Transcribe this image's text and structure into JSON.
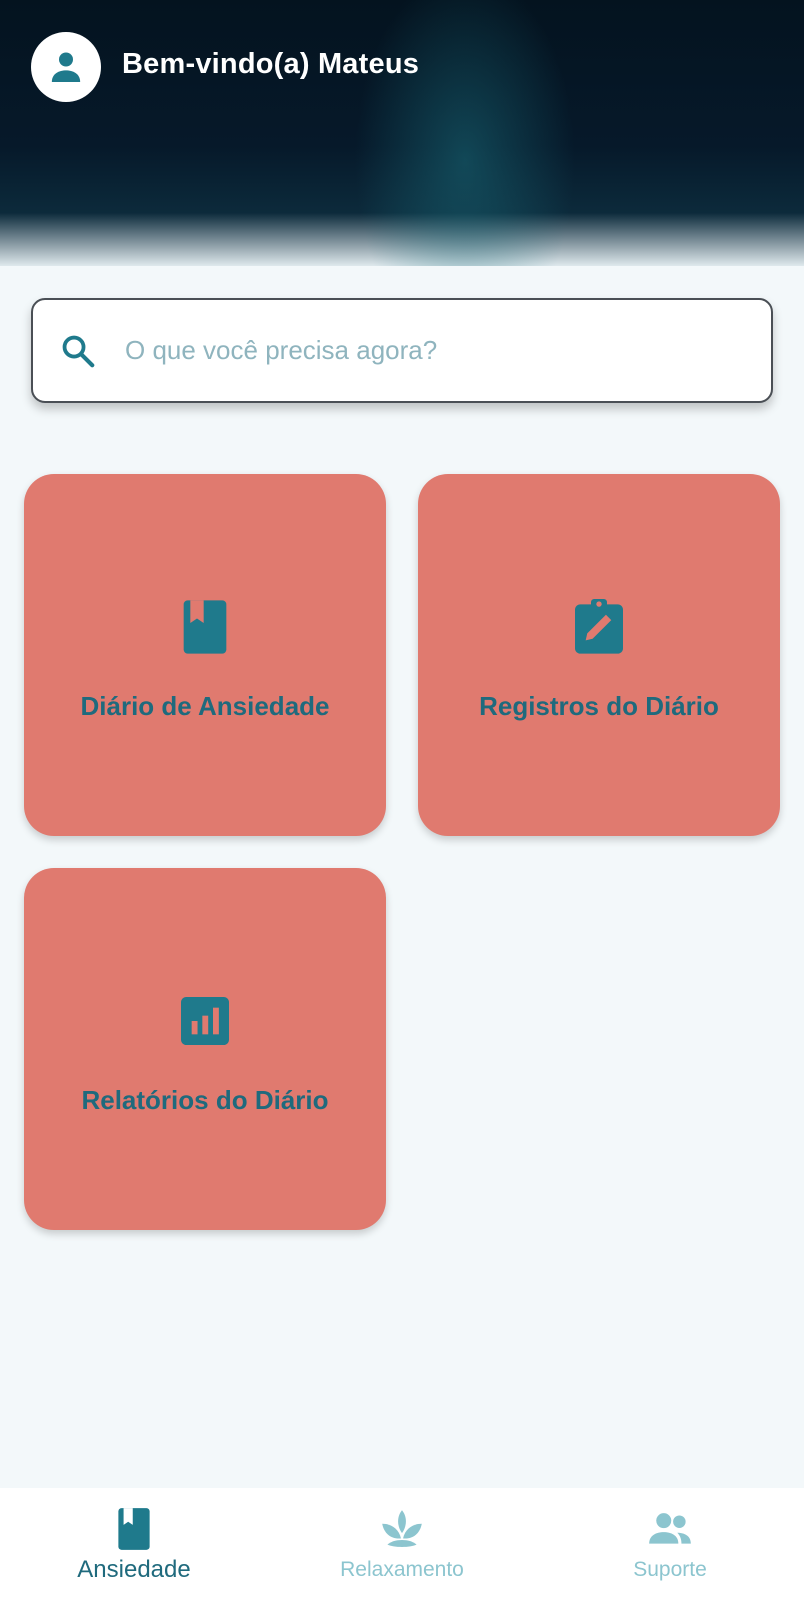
{
  "header": {
    "welcome_text": "Bem-vindo(a) Mateus",
    "avatar_icon": "person-icon"
  },
  "search": {
    "placeholder": "O que você precisa agora?",
    "value": "",
    "icon": "search-icon"
  },
  "cards": [
    {
      "label": "Diário de Ansiedade",
      "icon": "book-bookmark-icon"
    },
    {
      "label": "Registros do Diário",
      "icon": "clipboard-edit-icon"
    },
    {
      "label": "Relatórios do Diário",
      "icon": "bar-chart-icon"
    }
  ],
  "bottom_nav": {
    "active_index": 0,
    "items": [
      {
        "label": "Ansiedade",
        "icon": "book-icon"
      },
      {
        "label": "Relaxamento",
        "icon": "lotus-icon"
      },
      {
        "label": "Suporte",
        "icon": "group-icon"
      }
    ]
  },
  "colors": {
    "card_background": "#e07a6f",
    "accent": "#1f7a8c",
    "nav_inactive": "#8cc5cf",
    "page_background": "#f3f8fa"
  }
}
